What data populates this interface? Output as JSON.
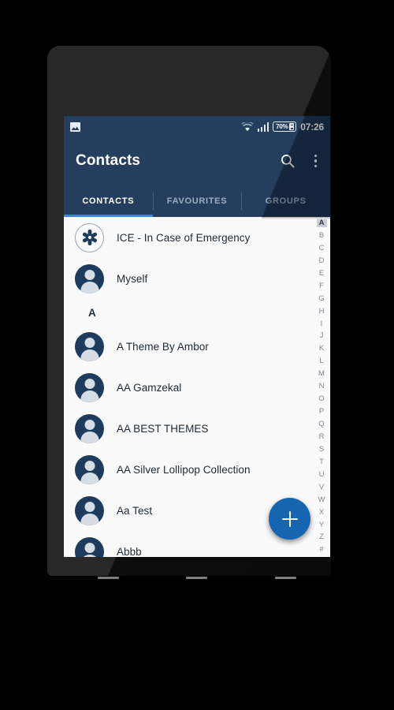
{
  "device": {
    "nav_buttons": [
      "back-dash",
      "home-dash",
      "recents-dash"
    ]
  },
  "statusbar": {
    "notification_icon": "photo-icon",
    "wifi_icon": "wifi-icon",
    "signal_icon": "cellular-signal-icon",
    "battery_level": "70%",
    "battery_icon": "battery-charging-icon",
    "time": "07:26"
  },
  "appbar": {
    "title": "Contacts",
    "search_icon": "search-icon",
    "overflow_icon": "more-vertical-icon"
  },
  "tabs": [
    {
      "label": "CONTACTS",
      "active": true
    },
    {
      "label": "FAVOURITES",
      "active": false
    },
    {
      "label": "GROUPS",
      "active": false
    }
  ],
  "list": [
    {
      "type": "contact",
      "name": "ICE - In Case of Emergency",
      "avatar": "star-of-life-icon"
    },
    {
      "type": "contact",
      "name": "Myself",
      "avatar": "person-avatar"
    },
    {
      "type": "section",
      "name": "A"
    },
    {
      "type": "contact",
      "name": "A Theme By Ambor",
      "avatar": "person-avatar"
    },
    {
      "type": "contact",
      "name": "AA  Gamzekal",
      "avatar": "person-avatar"
    },
    {
      "type": "contact",
      "name": "AA BEST THEMES",
      "avatar": "person-avatar"
    },
    {
      "type": "contact",
      "name": "AA Silver Lollipop Collection",
      "avatar": "person-avatar"
    },
    {
      "type": "contact",
      "name": "Aa Test",
      "avatar": "person-avatar"
    },
    {
      "type": "contact",
      "name": "Abbb",
      "avatar": "person-avatar"
    }
  ],
  "index_strip": {
    "selected": "A",
    "letters": [
      "A",
      "B",
      "C",
      "D",
      "E",
      "F",
      "G",
      "H",
      "I",
      "J",
      "K",
      "L",
      "M",
      "N",
      "O",
      "P",
      "Q",
      "R",
      "S",
      "T",
      "U",
      "V",
      "W",
      "X",
      "Y",
      "Z",
      "#"
    ]
  },
  "fab": {
    "icon": "plus-icon",
    "label": "Add contact"
  },
  "colors": {
    "app_bar": "#1d3656",
    "tab_indicator": "#3b7dd8",
    "fab": "#1565b0",
    "list_background": "#fafafa",
    "avatar_circle": "#1d3b5c"
  }
}
